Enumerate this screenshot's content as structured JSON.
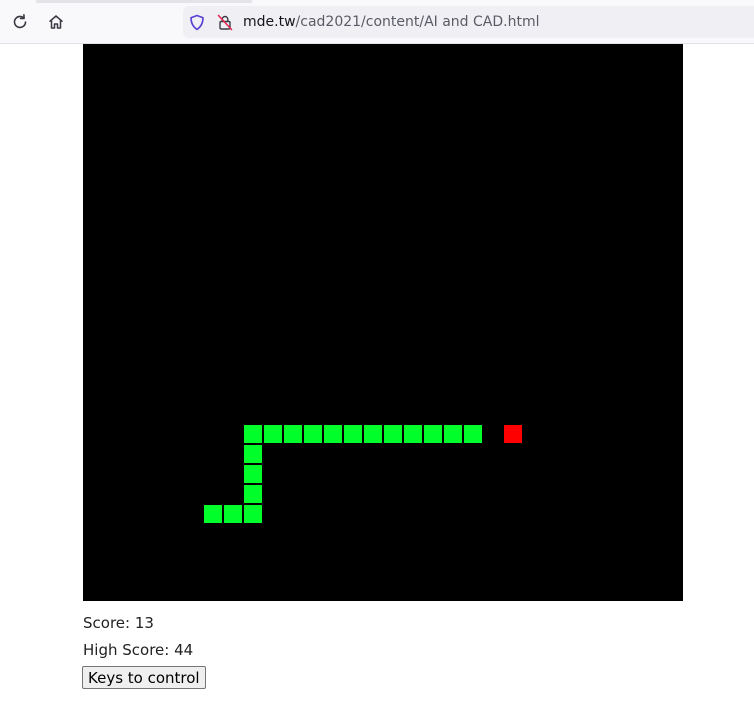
{
  "browser": {
    "url_host": "mde.tw",
    "url_path": "/cad2021/content/AI and CAD.html"
  },
  "game": {
    "background_color": "#000000",
    "snake_color": "#00ff2a",
    "food_color": "#ff0000",
    "snake": [
      [
        8,
        19
      ],
      [
        9,
        19
      ],
      [
        10,
        19
      ],
      [
        11,
        19
      ],
      [
        12,
        19
      ],
      [
        13,
        19
      ],
      [
        14,
        19
      ],
      [
        15,
        19
      ],
      [
        16,
        19
      ],
      [
        17,
        19
      ],
      [
        18,
        19
      ],
      [
        19,
        19
      ],
      [
        8,
        20
      ],
      [
        8,
        21
      ],
      [
        8,
        22
      ],
      [
        8,
        23
      ],
      [
        6,
        23
      ],
      [
        7,
        23
      ]
    ],
    "food": [
      21,
      19
    ]
  },
  "score": {
    "label": "Score: 13",
    "high_label": "High Score: 44"
  },
  "controls": {
    "button_label": "Keys to control"
  }
}
